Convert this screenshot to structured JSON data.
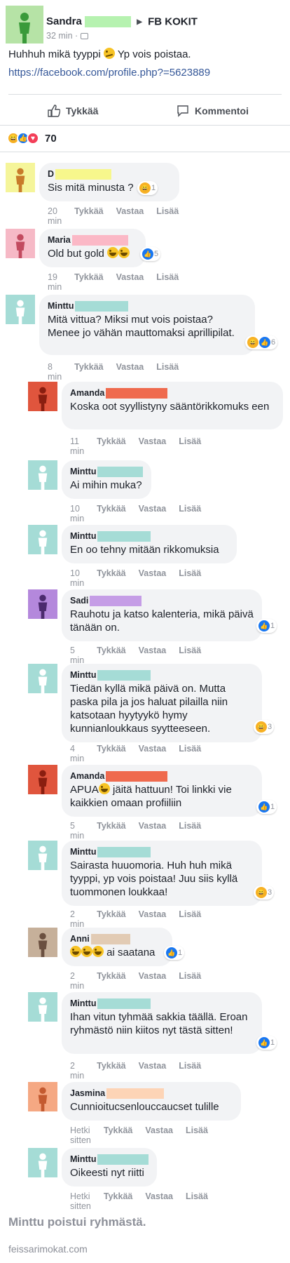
{
  "post": {
    "author": "Sandra",
    "group": "FB KOKIT",
    "time": "32 min",
    "meta_sep": "·",
    "text": "Huhhuh mikä tyyppi",
    "text_tail": "Yp vois poistaa.",
    "link": "https://facebook.com/profile.php?=5623889",
    "like_label": "Tykkää",
    "comment_label": "Kommentoi",
    "reaction_count": "70",
    "avatar_color": "#b6e3a6",
    "avatar_figure": "#3a9a3a"
  },
  "comment_actions": {
    "like": "Tykkää",
    "reply": "Vastaa",
    "more": "Lisää"
  },
  "comments": [
    {
      "name": "D",
      "text": "Sis mitä minusta ?",
      "time": "20 min",
      "react_count": "1",
      "avatar_bg": "#f5f59a",
      "avatar_fig": "#c87b2a",
      "redact": "#f7f78c"
    },
    {
      "name": "Maria",
      "text": "Old but gold",
      "time": "19 min",
      "react_count": "5",
      "avatar_bg": "#f6b9c6",
      "avatar_fig": "#c24a5f",
      "redact": "#fbb8c6"
    },
    {
      "name": "Minttu",
      "text": "Mitä vittua? Miksi mut vois poistaa? Menee jo vähän mauttomaksi aprillipilat.",
      "time": "8 min",
      "react_count": "6",
      "avatar_bg": "#a5dcd6",
      "avatar_fig": "#ffffff",
      "redact": "#a5dcd6"
    },
    {
      "name": "Amanda",
      "text": "Koska oot syyllistyny sääntörikkomuks een",
      "time": "11 min",
      "react_count": "",
      "avatar_bg": "#e0553d",
      "avatar_fig": "#8a1e10",
      "redact": "#ef6a4e"
    },
    {
      "name": "Minttu",
      "text": "Ai mihin muka?",
      "time": "10 min",
      "react_count": "",
      "avatar_bg": "#a5dcd6",
      "avatar_fig": "#ffffff",
      "redact": "#a5dcd6"
    },
    {
      "name": "Minttu",
      "text": "En oo tehny mitään rikkomuksia",
      "time": "10 min",
      "react_count": "",
      "avatar_bg": "#a5dcd6",
      "avatar_fig": "#ffffff",
      "redact": "#a5dcd6"
    },
    {
      "name": "Sadi",
      "text": "Rauhotu ja katso kalenteria, mikä päivä tänään on.",
      "time": "5 min",
      "react_count": "1",
      "avatar_bg": "#b488dc",
      "avatar_fig": "#4b2a6e",
      "redact": "#c59de6"
    },
    {
      "name": "Minttu",
      "text": "Tiedän kyllä mikä päivä on. Mutta paska pila ja jos haluat pilailla niin katsotaan hyytyykö hymy kunnianloukkaus syytteeseen.",
      "time": "4 min",
      "react_count": "3",
      "avatar_bg": "#a5dcd6",
      "avatar_fig": "#ffffff",
      "redact": "#a5dcd6"
    },
    {
      "name": "Amanda",
      "text": "APUA",
      "text_tail": "jäitä hattuun! Toi linkki vie kaikkien omaan profiiliin",
      "time": "5 min",
      "react_count": "1",
      "avatar_bg": "#e0553d",
      "avatar_fig": "#8a1e10",
      "redact": "#ef6a4e"
    },
    {
      "name": "Minttu",
      "text": "Sairasta huuomoria. Huh huh mikä tyyppi, yp vois poistaa! Juu siis kyllä tuommonen loukkaa!",
      "time": "2 min",
      "react_count": "3",
      "avatar_bg": "#a5dcd6",
      "avatar_fig": "#ffffff",
      "redact": "#a5dcd6"
    },
    {
      "name": "Anni",
      "text": "ai saatana",
      "time": "2 min",
      "react_count": "1",
      "avatar_bg": "#c6b09a",
      "avatar_fig": "#6b5040",
      "redact": "#e2cbb4"
    },
    {
      "name": "Minttu",
      "text": "Ihan vitun tyhmää sakkia täällä. Eroan ryhmästö niin kiitos nyt tästä sitten!",
      "time": "2 min",
      "react_count": "1",
      "avatar_bg": "#a5dcd6",
      "avatar_fig": "#ffffff",
      "redact": "#a5dcd6"
    },
    {
      "name": "Jasmina",
      "text": "Cunnioitucsenlouccaucset tulille",
      "time": "Hetki sitten",
      "react_count": "",
      "avatar_bg": "#f5a883",
      "avatar_fig": "#c45a30",
      "redact": "#fdd4b6"
    },
    {
      "name": "Minttu",
      "text": "Oikeesti nyt riitti",
      "time": "Hetki sitten",
      "react_count": "",
      "avatar_bg": "#a5dcd6",
      "avatar_fig": "#ffffff",
      "redact": "#a5dcd6"
    }
  ],
  "footer": {
    "note": "Minttu poistui ryhmästä.",
    "watermark": "feissarimokat.com"
  }
}
